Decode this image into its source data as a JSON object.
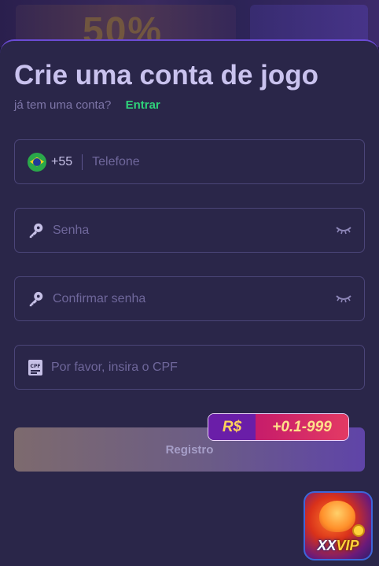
{
  "background": {
    "banner_left_text": "50%",
    "banner_right_text": ""
  },
  "form": {
    "title": "Crie uma conta de jogo",
    "have_account_text": "já tem uma conta?",
    "login_link": "Entrar",
    "phone": {
      "country_code": "+55",
      "placeholder": "Telefone",
      "flag_icon": "brazil-flag-icon"
    },
    "password": {
      "placeholder": "Senha",
      "icon": "key-icon"
    },
    "confirm_password": {
      "placeholder": "Confirmar senha",
      "icon": "key-icon"
    },
    "cpf": {
      "placeholder": "Por favor, insira o CPF",
      "icon": "cpf-card-icon"
    },
    "register_button": "Registro"
  },
  "promo": {
    "currency": "R$",
    "amount": "+0.1-999"
  },
  "vip_badge": {
    "prefix": "XX",
    "suffix": "VIP"
  },
  "colors": {
    "sheet_bg": "#2a2649",
    "accent_border": "#6b4bd6",
    "link_green": "#2fd17a",
    "title_color": "#c9c2ee"
  }
}
